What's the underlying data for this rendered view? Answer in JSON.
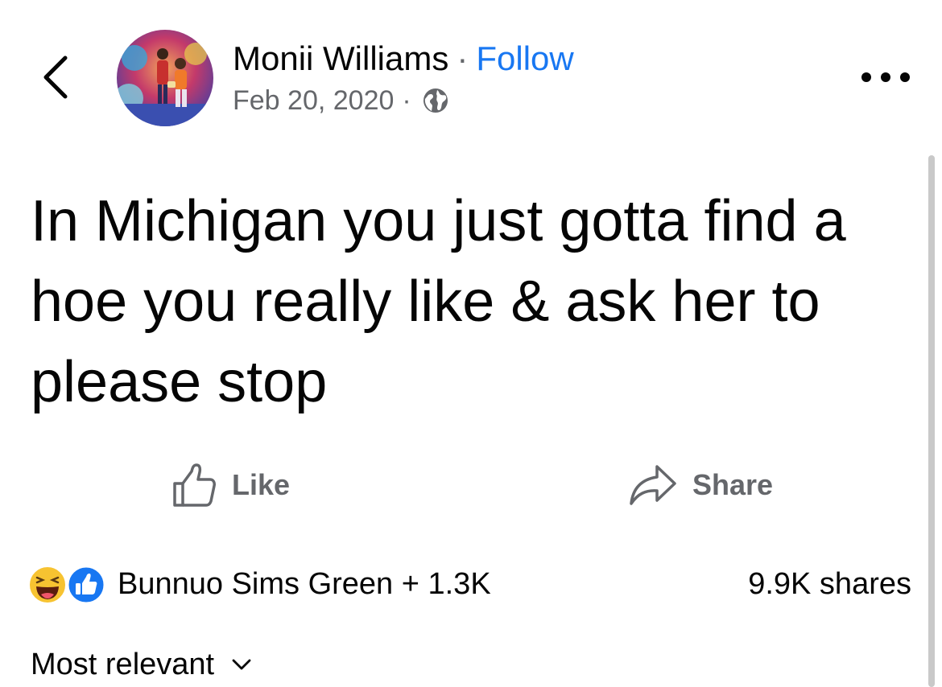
{
  "header": {
    "author_name": "Monii Williams",
    "separator": "·",
    "follow_label": "Follow",
    "date": "Feb 20, 2020",
    "audience_icon": "globe-icon",
    "back_icon": "chevron-left-icon",
    "more_icon": "ellipsis-icon"
  },
  "post": {
    "text": "In Michigan you just gotta find a hoe you really like & ask her to please stop"
  },
  "actions": {
    "like_label": "Like",
    "share_label": "Share"
  },
  "reactions": {
    "icons": [
      "haha-reaction-icon",
      "like-reaction-icon"
    ],
    "summary": "Bunnuo Sims Green + 1.3K",
    "shares": "9.9K shares"
  },
  "comments": {
    "sort_label": "Most relevant"
  },
  "colors": {
    "accent": "#1877f2",
    "secondary_text": "#65676b",
    "primary_text": "#050505"
  }
}
